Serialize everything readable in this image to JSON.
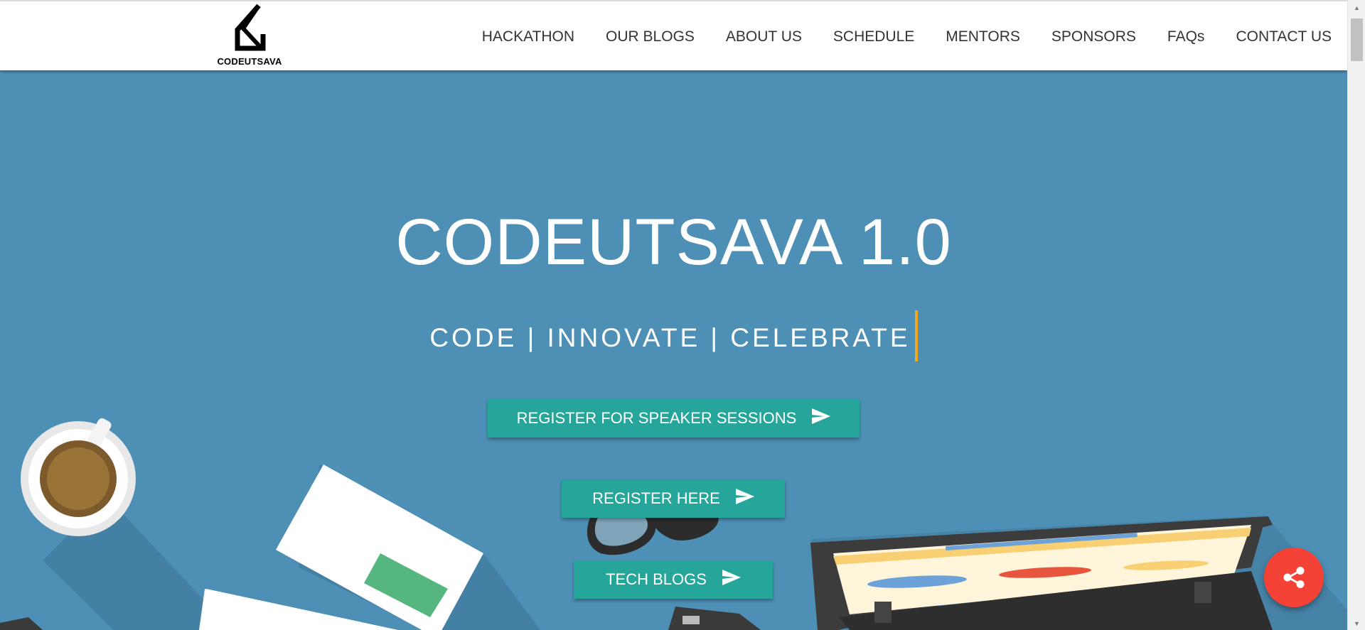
{
  "nav": {
    "logo_text": "CODEUTSAVA",
    "links": [
      "HACKATHON",
      "OUR BLOGS",
      "ABOUT US",
      "SCHEDULE",
      "MENTORS",
      "SPONSORS",
      "FAQs",
      "CONTACT US"
    ]
  },
  "hero": {
    "title": "CODEUTSAVA 1.0",
    "tagline": "CODE | INNOVATE | CELEBRATE",
    "buttons": {
      "speaker": "REGISTER FOR SPEAKER SESSIONS",
      "register": "REGISTER HERE",
      "blogs": "TECH BLOGS"
    }
  },
  "colors": {
    "hero_background": "#4d8fb5",
    "button": "#26a69a",
    "fab": "#f44336",
    "cursor": "#f2a81d"
  },
  "icons": {
    "button_icon": "send-icon",
    "fab_icon": "share-icon"
  }
}
